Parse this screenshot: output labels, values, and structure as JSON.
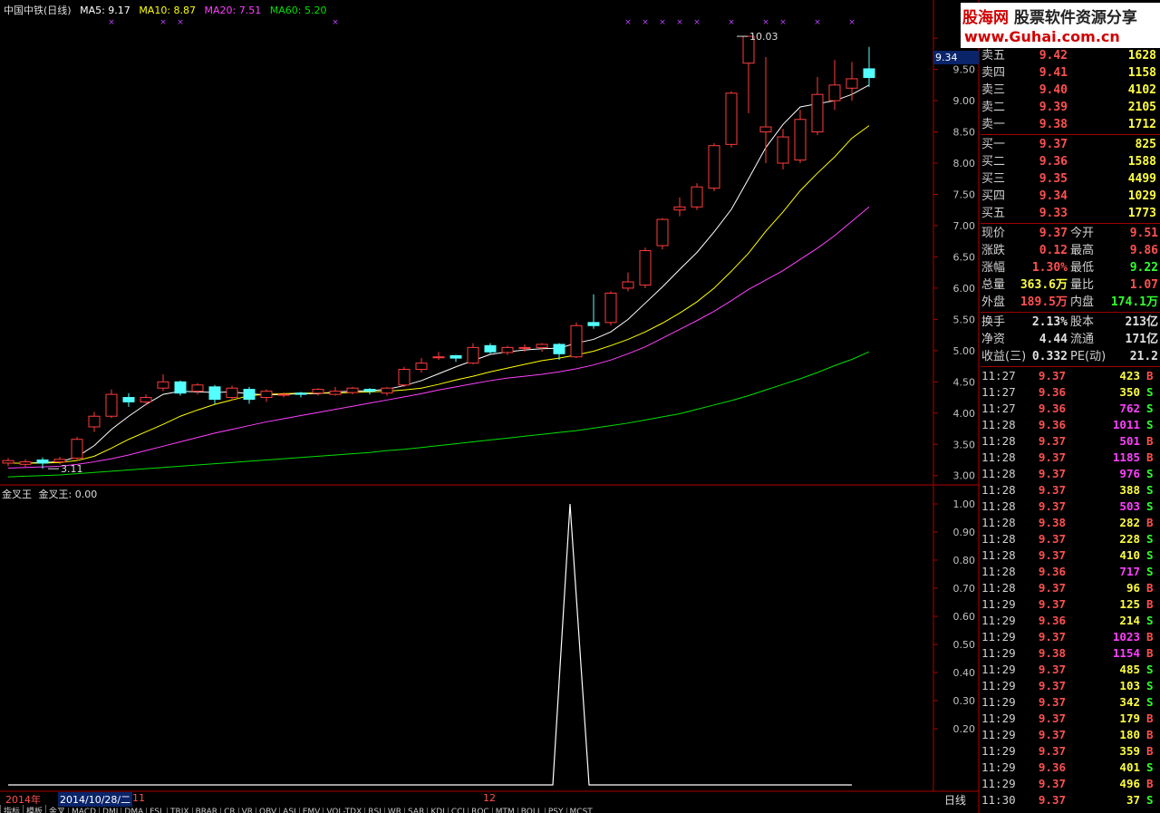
{
  "header": {
    "title": "中国中铁(日线)",
    "ma5": "MA5: 9.17",
    "ma10": "MA10: 8.87",
    "ma20": "MA20: 7.51",
    "ma60": "MA60: 5.20",
    "colors": {
      "ma5": "#ffffff",
      "ma10": "#ffff00",
      "ma20": "#ff40ff",
      "ma60": "#00e000"
    }
  },
  "indicator_header": {
    "name": "金叉王",
    "value": "金叉王: 0.00"
  },
  "logo": {
    "line1a": "股海网",
    "line1b": "股票软件资源分享",
    "line2": "www.Guhai.com.cn"
  },
  "price_tag": "9.34",
  "order_book": {
    "sell": [
      {
        "label": "卖五",
        "price": "9.42",
        "vol": "1628"
      },
      {
        "label": "卖四",
        "price": "9.41",
        "vol": "1158"
      },
      {
        "label": "卖三",
        "price": "9.40",
        "vol": "4102"
      },
      {
        "label": "卖二",
        "price": "9.39",
        "vol": "2105"
      },
      {
        "label": "卖一",
        "price": "9.38",
        "vol": "1712"
      }
    ],
    "buy": [
      {
        "label": "买一",
        "price": "9.37",
        "vol": "825"
      },
      {
        "label": "买二",
        "price": "9.36",
        "vol": "1588"
      },
      {
        "label": "买三",
        "price": "9.35",
        "vol": "4499"
      },
      {
        "label": "买四",
        "price": "9.34",
        "vol": "1029"
      },
      {
        "label": "买五",
        "price": "9.33",
        "vol": "1773"
      }
    ]
  },
  "quote": [
    {
      "l1": "现价",
      "v1": "9.37",
      "c1": "red",
      "l2": "今开",
      "v2": "9.51",
      "c2": "red"
    },
    {
      "l1": "涨跌",
      "v1": "0.12",
      "c1": "red",
      "l2": "最高",
      "v2": "9.86",
      "c2": "red"
    },
    {
      "l1": "涨幅",
      "v1": "1.30%",
      "c1": "red",
      "l2": "最低",
      "v2": "9.22",
      "c2": "grn"
    },
    {
      "l1": "总量",
      "v1": "363.6万",
      "c1": "yel",
      "l2": "量比",
      "v2": "1.07",
      "c2": "red"
    },
    {
      "l1": "外盘",
      "v1": "189.5万",
      "c1": "red",
      "l2": "内盘",
      "v2": "174.1万",
      "c2": "grn"
    }
  ],
  "quote2": [
    {
      "l1": "换手",
      "v1": "2.13%",
      "l2": "股本",
      "v2": "213亿"
    },
    {
      "l1": "净资",
      "v1": "4.44",
      "l2": "流通",
      "v2": "171亿"
    },
    {
      "l1": "收益(三)",
      "v1": "0.332",
      "l2": "PE(动)",
      "v2": "21.2"
    }
  ],
  "ticks": [
    {
      "t": "11:27",
      "p": "9.37",
      "v": "423",
      "f": "B",
      "vc": "yel"
    },
    {
      "t": "11:27",
      "p": "9.36",
      "v": "350",
      "f": "S",
      "vc": "yel"
    },
    {
      "t": "11:27",
      "p": "9.36",
      "v": "762",
      "f": "S",
      "vc": "mag"
    },
    {
      "t": "11:28",
      "p": "9.36",
      "v": "1011",
      "f": "S",
      "vc": "mag"
    },
    {
      "t": "11:28",
      "p": "9.37",
      "v": "501",
      "f": "B",
      "vc": "mag"
    },
    {
      "t": "11:28",
      "p": "9.37",
      "v": "1185",
      "f": "B",
      "vc": "mag"
    },
    {
      "t": "11:28",
      "p": "9.37",
      "v": "976",
      "f": "S",
      "vc": "mag"
    },
    {
      "t": "11:28",
      "p": "9.37",
      "v": "388",
      "f": "S",
      "vc": "yel"
    },
    {
      "t": "11:28",
      "p": "9.37",
      "v": "503",
      "f": "S",
      "vc": "mag"
    },
    {
      "t": "11:28",
      "p": "9.38",
      "v": "282",
      "f": "B",
      "vc": "yel"
    },
    {
      "t": "11:28",
      "p": "9.37",
      "v": "228",
      "f": "S",
      "vc": "yel"
    },
    {
      "t": "11:28",
      "p": "9.37",
      "v": "410",
      "f": "S",
      "vc": "yel"
    },
    {
      "t": "11:28",
      "p": "9.36",
      "v": "717",
      "f": "S",
      "vc": "mag"
    },
    {
      "t": "11:28",
      "p": "9.37",
      "v": "96",
      "f": "B",
      "vc": "yel"
    },
    {
      "t": "11:29",
      "p": "9.37",
      "v": "125",
      "f": "B",
      "vc": "yel"
    },
    {
      "t": "11:29",
      "p": "9.36",
      "v": "214",
      "f": "S",
      "vc": "yel"
    },
    {
      "t": "11:29",
      "p": "9.37",
      "v": "1023",
      "f": "B",
      "vc": "mag"
    },
    {
      "t": "11:29",
      "p": "9.38",
      "v": "1154",
      "f": "B",
      "vc": "mag"
    },
    {
      "t": "11:29",
      "p": "9.37",
      "v": "485",
      "f": "S",
      "vc": "yel"
    },
    {
      "t": "11:29",
      "p": "9.37",
      "v": "103",
      "f": "S",
      "vc": "yel"
    },
    {
      "t": "11:29",
      "p": "9.37",
      "v": "342",
      "f": "S",
      "vc": "yel"
    },
    {
      "t": "11:29",
      "p": "9.37",
      "v": "179",
      "f": "B",
      "vc": "yel"
    },
    {
      "t": "11:29",
      "p": "9.37",
      "v": "180",
      "f": "B",
      "vc": "yel"
    },
    {
      "t": "11:29",
      "p": "9.37",
      "v": "359",
      "f": "B",
      "vc": "yel"
    },
    {
      "t": "11:29",
      "p": "9.36",
      "v": "401",
      "f": "S",
      "vc": "yel"
    },
    {
      "t": "11:29",
      "p": "9.37",
      "v": "496",
      "f": "B",
      "vc": "yel"
    },
    {
      "t": "11:30",
      "p": "9.37",
      "v": "37",
      "f": "S",
      "vc": "yel"
    }
  ],
  "bottom": {
    "year": "2014年",
    "date": "2014/10/28/二",
    "m11": "11",
    "m12": "12",
    "period": "日线"
  },
  "tabs": [
    "指标",
    "模板",
    "金叉",
    "MACD",
    "DMI",
    "DMA",
    "FSL",
    "TRIX",
    "BRAR",
    "CR",
    "VR",
    "OBV",
    "ASI",
    "EMV",
    "VOL-TDX",
    "RSI",
    "WR",
    "SAR",
    "KDJ",
    "CCI",
    "ROC",
    "MTM",
    "BOLL",
    "PSY",
    "MCST"
  ],
  "chart_data": [
    {
      "type": "candlestick",
      "title": "中国中铁(日线)",
      "y_ticks": [
        "10",
        "9.50",
        "9.00",
        "8.50",
        "8.00",
        "7.50",
        "7.00",
        "6.50",
        "6.00",
        "5.50",
        "5.00",
        "4.50",
        "4.00",
        "3.50",
        "3.00"
      ],
      "ylim": [
        2.88,
        10.35
      ],
      "annotations": [
        {
          "text": "10.03",
          "index": 42,
          "value": 10.03
        },
        {
          "text": "3.11",
          "index": 2,
          "value": 3.11
        }
      ],
      "candles": [
        [
          3.2,
          3.24,
          3.15,
          3.28
        ],
        [
          3.18,
          3.22,
          3.14,
          3.26
        ],
        [
          3.25,
          3.2,
          3.11,
          3.29
        ],
        [
          3.22,
          3.26,
          3.18,
          3.3
        ],
        [
          3.28,
          3.58,
          3.24,
          3.62
        ],
        [
          3.78,
          3.95,
          3.7,
          4.02
        ],
        [
          3.95,
          4.3,
          3.92,
          4.38
        ],
        [
          4.25,
          4.18,
          4.1,
          4.32
        ],
        [
          4.18,
          4.25,
          4.12,
          4.3
        ],
        [
          4.4,
          4.5,
          4.35,
          4.62
        ],
        [
          4.5,
          4.32,
          4.28,
          4.52
        ],
        [
          4.35,
          4.45,
          4.3,
          4.48
        ],
        [
          4.42,
          4.22,
          4.15,
          4.45
        ],
        [
          4.25,
          4.4,
          4.2,
          4.44
        ],
        [
          4.38,
          4.22,
          4.15,
          4.42
        ],
        [
          4.25,
          4.35,
          4.18,
          4.38
        ],
        [
          4.3,
          4.3,
          4.25,
          4.33
        ],
        [
          4.32,
          4.3,
          4.25,
          4.34
        ],
        [
          4.32,
          4.38,
          4.28,
          4.4
        ],
        [
          4.3,
          4.35,
          4.28,
          4.42
        ],
        [
          4.33,
          4.4,
          4.3,
          4.42
        ],
        [
          4.38,
          4.35,
          4.3,
          4.4
        ],
        [
          4.32,
          4.4,
          4.28,
          4.42
        ],
        [
          4.45,
          4.7,
          4.42,
          4.74
        ],
        [
          4.7,
          4.8,
          4.65,
          4.88
        ],
        [
          4.9,
          4.9,
          4.85,
          4.98
        ],
        [
          4.92,
          4.88,
          4.82,
          4.93
        ],
        [
          4.8,
          5.05,
          4.78,
          5.12
        ],
        [
          5.08,
          4.98,
          4.95,
          5.12
        ],
        [
          4.97,
          5.05,
          4.93,
          5.08
        ],
        [
          5.05,
          5.05,
          4.98,
          5.1
        ],
        [
          5.05,
          5.1,
          4.98,
          5.12
        ],
        [
          5.1,
          4.95,
          4.85,
          5.12
        ],
        [
          4.9,
          5.4,
          4.88,
          5.45
        ],
        [
          5.45,
          5.4,
          5.35,
          5.9
        ],
        [
          5.45,
          5.92,
          5.4,
          5.95
        ],
        [
          6.0,
          6.1,
          5.95,
          6.25
        ],
        [
          6.05,
          6.6,
          6.0,
          6.65
        ],
        [
          6.68,
          7.1,
          6.62,
          7.12
        ],
        [
          7.25,
          7.3,
          7.15,
          7.45
        ],
        [
          7.3,
          7.62,
          7.25,
          7.68
        ],
        [
          7.6,
          8.28,
          7.55,
          8.32
        ],
        [
          8.3,
          9.12,
          8.25,
          9.15
        ],
        [
          9.6,
          10.03,
          8.8,
          10.03
        ],
        [
          8.5,
          8.58,
          8.0,
          9.7
        ],
        [
          8.0,
          8.42,
          7.9,
          8.55
        ],
        [
          8.05,
          8.7,
          8.0,
          8.85
        ],
        [
          8.5,
          9.1,
          8.45,
          9.38
        ],
        [
          9.0,
          9.25,
          8.85,
          9.65
        ],
        [
          9.2,
          9.35,
          9.0,
          9.62
        ],
        [
          9.51,
          9.37,
          9.22,
          9.86
        ]
      ],
      "ma": [
        {
          "name": "MA5",
          "color": "#ffffff",
          "values": [
            3.2,
            3.2,
            3.21,
            3.22,
            3.3,
            3.48,
            3.74,
            3.95,
            4.14,
            4.3,
            4.35,
            4.34,
            4.33,
            4.34,
            4.31,
            4.29,
            4.3,
            4.31,
            4.31,
            4.34,
            4.35,
            4.36,
            4.38,
            4.44,
            4.52,
            4.63,
            4.74,
            4.84,
            4.94,
            4.98,
            5.01,
            5.03,
            5.04,
            5.12,
            5.18,
            5.3,
            5.5,
            5.76,
            6.02,
            6.3,
            6.57,
            6.9,
            7.26,
            7.75,
            8.25,
            8.62,
            8.9,
            8.95,
            9.0,
            9.1,
            9.25
          ]
        },
        {
          "name": "MA10",
          "color": "#ffff00",
          "values": [
            3.2,
            3.2,
            3.2,
            3.21,
            3.24,
            3.31,
            3.44,
            3.58,
            3.7,
            3.82,
            3.95,
            4.05,
            4.14,
            4.21,
            4.28,
            4.3,
            4.31,
            4.32,
            4.32,
            4.32,
            4.33,
            4.34,
            4.35,
            4.37,
            4.4,
            4.46,
            4.53,
            4.59,
            4.66,
            4.72,
            4.78,
            4.84,
            4.88,
            4.93,
            4.99,
            5.08,
            5.18,
            5.3,
            5.44,
            5.6,
            5.78,
            6.0,
            6.27,
            6.56,
            6.91,
            7.22,
            7.56,
            7.84,
            8.1,
            8.4,
            8.6
          ]
        },
        {
          "name": "MA20",
          "color": "#ff40ff",
          "values": [
            3.12,
            3.13,
            3.14,
            3.15,
            3.18,
            3.22,
            3.27,
            3.33,
            3.4,
            3.47,
            3.54,
            3.61,
            3.68,
            3.74,
            3.8,
            3.86,
            3.91,
            3.96,
            4.01,
            4.06,
            4.11,
            4.16,
            4.21,
            4.26,
            4.31,
            4.37,
            4.42,
            4.47,
            4.52,
            4.56,
            4.59,
            4.62,
            4.66,
            4.71,
            4.77,
            4.85,
            4.95,
            5.06,
            5.2,
            5.34,
            5.48,
            5.63,
            5.8,
            5.98,
            6.13,
            6.28,
            6.46,
            6.64,
            6.84,
            7.07,
            7.3
          ]
        },
        {
          "name": "MA60",
          "color": "#00e000",
          "values": [
            2.98,
            2.99,
            3.0,
            3.01,
            3.03,
            3.05,
            3.07,
            3.09,
            3.11,
            3.13,
            3.15,
            3.17,
            3.19,
            3.21,
            3.23,
            3.25,
            3.27,
            3.29,
            3.31,
            3.33,
            3.35,
            3.37,
            3.4,
            3.42,
            3.45,
            3.48,
            3.51,
            3.54,
            3.57,
            3.6,
            3.63,
            3.66,
            3.69,
            3.72,
            3.76,
            3.8,
            3.84,
            3.89,
            3.94,
            3.99,
            4.06,
            4.13,
            4.2,
            4.28,
            4.37,
            4.46,
            4.55,
            4.65,
            4.76,
            4.86,
            4.98
          ]
        }
      ],
      "markers": [
        6,
        9,
        10,
        19,
        36,
        37,
        38,
        39,
        40,
        42,
        44,
        45,
        47,
        49
      ]
    },
    {
      "type": "line",
      "title": "金叉王",
      "y_ticks": [
        "1.00",
        "0.90",
        "0.80",
        "0.70",
        "0.60",
        "0.50",
        "0.40",
        "0.30",
        "0.20"
      ],
      "ylim": [
        0,
        1.0
      ],
      "points": [
        [
          0,
          0
        ],
        [
          31,
          0
        ],
        [
          32,
          1.0
        ],
        [
          33,
          0
        ],
        [
          49,
          0
        ]
      ]
    }
  ]
}
